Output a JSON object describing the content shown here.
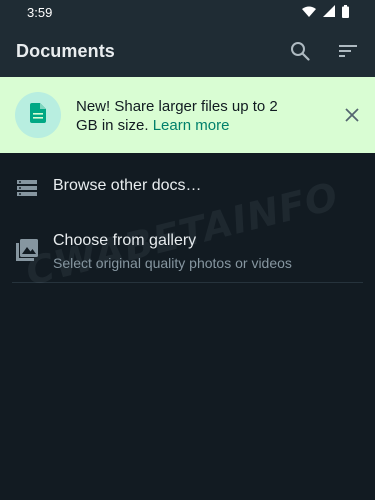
{
  "status_bar": {
    "time": "3:59"
  },
  "app_bar": {
    "title": "Documents",
    "search_icon": "search-icon",
    "sort_icon": "sort-icon"
  },
  "banner": {
    "icon": "document-icon",
    "text": "New! Share larger files up to 2 GB in size.",
    "link": "Learn more",
    "close_icon": "close-icon",
    "colors": {
      "background": "#d9fdd3",
      "icon_circle": "#b8eee0",
      "link": "#00806b"
    }
  },
  "items": [
    {
      "icon": "storage-icon",
      "label": "Browse other docs…"
    },
    {
      "icon": "gallery-icon",
      "label": "Choose from gallery",
      "subtitle": "Select original quality photos or videos"
    }
  ],
  "watermark": "CWABETAINFO"
}
